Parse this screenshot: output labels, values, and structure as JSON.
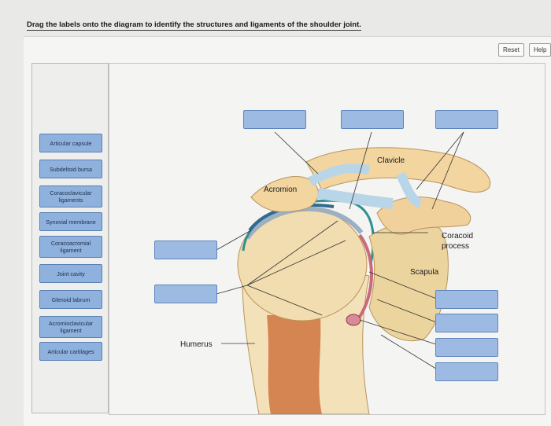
{
  "question": "Drag the labels onto the diagram to identify the structures and ligaments of the shoulder joint.",
  "buttons": {
    "reset": "Reset",
    "help": "Help"
  },
  "labels": [
    {
      "line1": "Articular capsule",
      "line2": ""
    },
    {
      "line1": "Subdeltoid bursa",
      "line2": ""
    },
    {
      "line1": "Coracoclavicular",
      "line2": "ligaments"
    },
    {
      "line1": "Synovial membrane",
      "line2": ""
    },
    {
      "line1": "Coracoacromial",
      "line2": "ligament"
    },
    {
      "line1": "Joint cavity",
      "line2": ""
    },
    {
      "line1": "Glenoid labrum",
      "line2": ""
    },
    {
      "line1": "Acromioclavicular",
      "line2": "ligament"
    },
    {
      "line1": "Articular cartilages",
      "line2": ""
    }
  ],
  "diagram": {
    "clavicle": "Clavicle",
    "acromion": "Acromion",
    "coracoid_1": "Coracoid",
    "coracoid_2": "process",
    "scapula": "Scapula",
    "humerus": "Humerus"
  },
  "colors": {
    "label_fill": "#8fb1dd",
    "drop_fill": "#9dbbe2",
    "bone": "#f0d9a8",
    "ligament": "#b8d6e8",
    "capsule": "#2f8f92"
  }
}
